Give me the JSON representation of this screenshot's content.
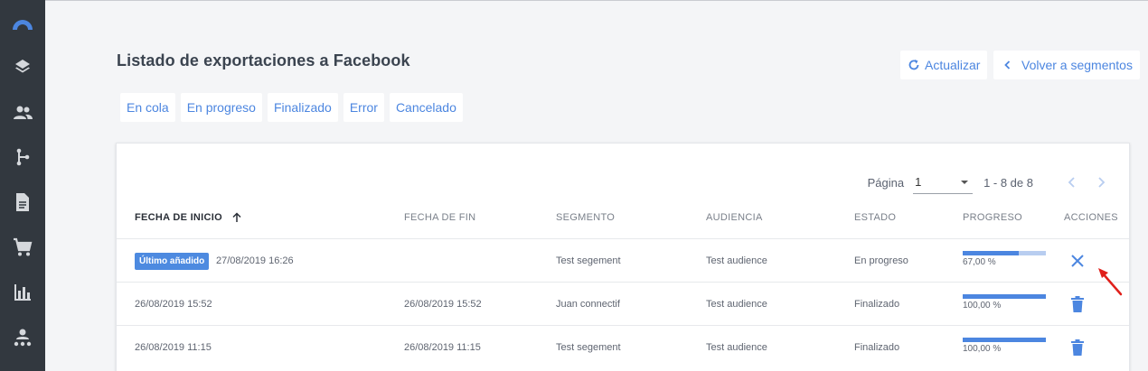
{
  "page": {
    "title": "Listado de exportaciones a Facebook",
    "refresh_label": "Actualizar",
    "back_label": "Volver a segmentos"
  },
  "sidebar": {
    "items": [
      {
        "icon": "logo-arc-icon"
      },
      {
        "icon": "layers-icon"
      },
      {
        "icon": "people-icon"
      },
      {
        "icon": "flow-branch-icon"
      },
      {
        "icon": "document-icon"
      },
      {
        "icon": "cart-icon"
      },
      {
        "icon": "bar-chart-icon"
      },
      {
        "icon": "person-network-icon"
      }
    ]
  },
  "filters": [
    "En cola",
    "En progreso",
    "Finalizado",
    "Error",
    "Cancelado"
  ],
  "pager": {
    "label": "Página",
    "page": "1",
    "range": "1 - 8 de 8"
  },
  "table": {
    "headers": {
      "start": "FECHA DE INICIO",
      "end": "FECHA DE FIN",
      "segment": "SEGMENTO",
      "audience": "AUDIENCIA",
      "state": "ESTADO",
      "progress": "PROGRESO",
      "actions": "ACCIONES"
    },
    "rows": [
      {
        "badge": "Último añadido",
        "start": "27/08/2019 16:26",
        "end": "",
        "segment": "Test segement",
        "audience": "Test audience",
        "state": "En progreso",
        "progress_text": "67,00 %",
        "progress": 0.67,
        "action": "cancel"
      },
      {
        "badge": "",
        "start": "26/08/2019 15:52",
        "end": "26/08/2019 15:52",
        "segment": "Juan connectif",
        "audience": "Test audience",
        "state": "Finalizado",
        "progress_text": "100,00 %",
        "progress": 1.0,
        "action": "delete"
      },
      {
        "badge": "",
        "start": "26/08/2019 11:15",
        "end": "26/08/2019 11:15",
        "segment": "Test segement",
        "audience": "Test audience",
        "state": "Finalizado",
        "progress_text": "100,00 %",
        "progress": 1.0,
        "action": "delete"
      }
    ]
  },
  "colors": {
    "accent": "#4c86e0",
    "sidebar": "#32383f",
    "arrow": "#e0201b"
  }
}
